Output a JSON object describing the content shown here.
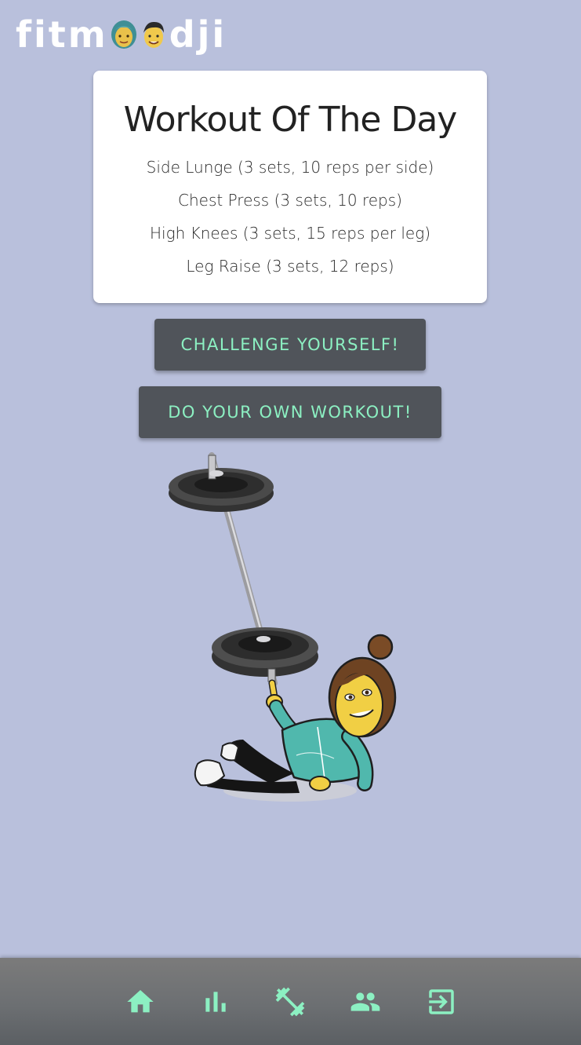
{
  "logo": {
    "prefix": "fitm",
    "suffix": "dji"
  },
  "workout_card": {
    "title": "Workout Of The Day",
    "exercises": [
      "Side Lunge (3 sets, 10 reps per side)",
      "Chest Press (3 sets, 10 reps)",
      "High Knees (3 sets, 15 reps per leg)",
      "Leg Raise (3 sets, 12 reps)"
    ]
  },
  "buttons": {
    "challenge": "CHALLENGE YOURSELF!",
    "own_workout": "DO YOUR OWN WORKOUT!"
  },
  "nav": {
    "items": [
      {
        "icon": "home-icon"
      },
      {
        "icon": "bar-chart-icon"
      },
      {
        "icon": "dumbbell-icon"
      },
      {
        "icon": "group-icon"
      },
      {
        "icon": "logout-icon"
      }
    ]
  },
  "colors": {
    "background": "#b9c0dc",
    "accent": "#8cf0c2",
    "button": "#50545a",
    "nav": "#6c6f72"
  }
}
